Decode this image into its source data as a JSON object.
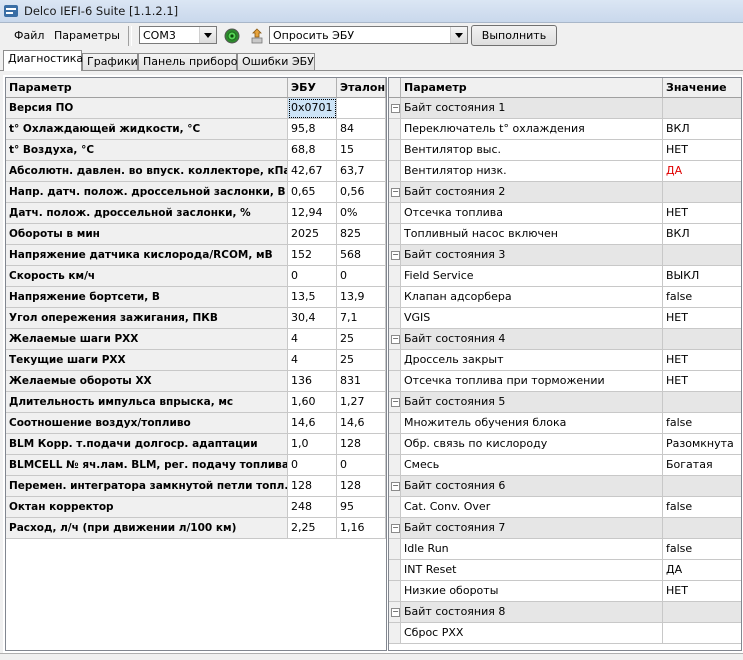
{
  "window": {
    "title": "Delco IEFI-6 Suite [1.1.2.1]"
  },
  "toolbar": {
    "menu": [
      {
        "label": "Файл"
      },
      {
        "label": "Параметры"
      }
    ],
    "port": "COM3",
    "action": "Опросить ЭБУ",
    "run_label": "Выполнить"
  },
  "tabs": [
    {
      "label": "Диагностика"
    },
    {
      "label": "Графики"
    },
    {
      "label": "Панель приборов"
    },
    {
      "label": "Ошибки ЭБУ"
    }
  ],
  "left": {
    "headers": {
      "param": "Параметр",
      "ecu": "ЭБУ",
      "ref": "Эталон"
    },
    "rows": [
      {
        "param": "Версия ПО",
        "ecu": "0x0701",
        "ref": ""
      },
      {
        "param": "t° Охлаждающей жидкости, °C",
        "ecu": "95,8",
        "ref": "84"
      },
      {
        "param": "t° Воздуха, °C",
        "ecu": "68,8",
        "ref": "15"
      },
      {
        "param": "Абсолютн. давлен. во впуск. коллекторе, кПа",
        "ecu": "42,67",
        "ref": "63,7"
      },
      {
        "param": "Напр. датч. полож. дроссельной заслонки, В",
        "ecu": "0,65",
        "ref": "0,56"
      },
      {
        "param": "Датч. полож. дроссельной заслонки, %",
        "ecu": "12,94",
        "ref": "0%"
      },
      {
        "param": "Обороты в мин",
        "ecu": "2025",
        "ref": "825"
      },
      {
        "param": "Напряжение датчика кислорода/RCOM, мВ",
        "ecu": "152",
        "ref": "568"
      },
      {
        "param": "Скорость км/ч",
        "ecu": "0",
        "ref": "0"
      },
      {
        "param": "Напряжение бортсети, В",
        "ecu": "13,5",
        "ref": "13,9"
      },
      {
        "param": "Угол опережения зажигания, ПКВ",
        "ecu": "30,4",
        "ref": "7,1"
      },
      {
        "param": "Желаемые шаги РХХ",
        "ecu": "4",
        "ref": "25"
      },
      {
        "param": "Текущие шаги РХХ",
        "ecu": "4",
        "ref": "25"
      },
      {
        "param": "Желаемые обороты ХХ",
        "ecu": "136",
        "ref": "831"
      },
      {
        "param": "Длительность импульса впрыска, мс",
        "ecu": "1,60",
        "ref": "1,27"
      },
      {
        "param": "Соотношение воздух/топливо",
        "ecu": "14,6",
        "ref": "14,6"
      },
      {
        "param": "BLM Корр. т.подачи долгоср. адаптации",
        "ecu": "1,0",
        "ref": "128"
      },
      {
        "param": "BLMCELL № яч.лам. BLM, рег. подачу топлива",
        "ecu": "0",
        "ref": "0"
      },
      {
        "param": "Перемен. интегратора замкнутой петли топл.",
        "ecu": "128",
        "ref": "128"
      },
      {
        "param": "Октан корректор",
        "ecu": "248",
        "ref": "95"
      },
      {
        "param": "Расход, л/ч (при движении л/100 км)",
        "ecu": "2,25",
        "ref": "1,16"
      }
    ]
  },
  "right": {
    "headers": {
      "param": "Параметр",
      "value": "Значение"
    },
    "rows": [
      {
        "group": true,
        "param": "Байт состояния 1",
        "value": ""
      },
      {
        "param": "Переключатель t° охлаждения",
        "value": "ВКЛ"
      },
      {
        "param": "Вентилятор выс.",
        "value": "НЕТ"
      },
      {
        "param": "Вентилятор низк.",
        "value": "ДА",
        "alert": true
      },
      {
        "group": true,
        "param": "Байт состояния 2",
        "value": ""
      },
      {
        "param": "Отсечка топлива",
        "value": "НЕТ"
      },
      {
        "param": "Топливный насос включен",
        "value": "ВКЛ"
      },
      {
        "group": true,
        "param": "Байт состояния 3",
        "value": ""
      },
      {
        "param": "Field Service",
        "value": "ВЫКЛ"
      },
      {
        "param": "Клапан адсорбера",
        "value": "false"
      },
      {
        "param": "VGIS",
        "value": "НЕТ"
      },
      {
        "group": true,
        "param": "Байт состояния 4",
        "value": ""
      },
      {
        "param": "Дроссель закрыт",
        "value": "НЕТ"
      },
      {
        "param": "Отсечка топлива при торможении",
        "value": "НЕТ"
      },
      {
        "group": true,
        "param": "Байт состояния 5",
        "value": ""
      },
      {
        "param": "Множитель обучения блока",
        "value": "false"
      },
      {
        "param": "Обр. связь по кислороду",
        "value": "Разомкнута"
      },
      {
        "param": "Смесь",
        "value": "Богатая"
      },
      {
        "group": true,
        "param": "Байт состояния 6",
        "value": ""
      },
      {
        "param": "Cat. Conv. Over",
        "value": "false"
      },
      {
        "group": true,
        "param": "Байт состояния 7",
        "value": ""
      },
      {
        "param": "Idle Run",
        "value": "false"
      },
      {
        "param": "INT Reset",
        "value": "ДА"
      },
      {
        "param": "Низкие обороты",
        "value": "НЕТ"
      },
      {
        "group": true,
        "param": "Байт состояния 8",
        "value": ""
      },
      {
        "param": "Сброс РХХ",
        "value": ""
      }
    ]
  }
}
